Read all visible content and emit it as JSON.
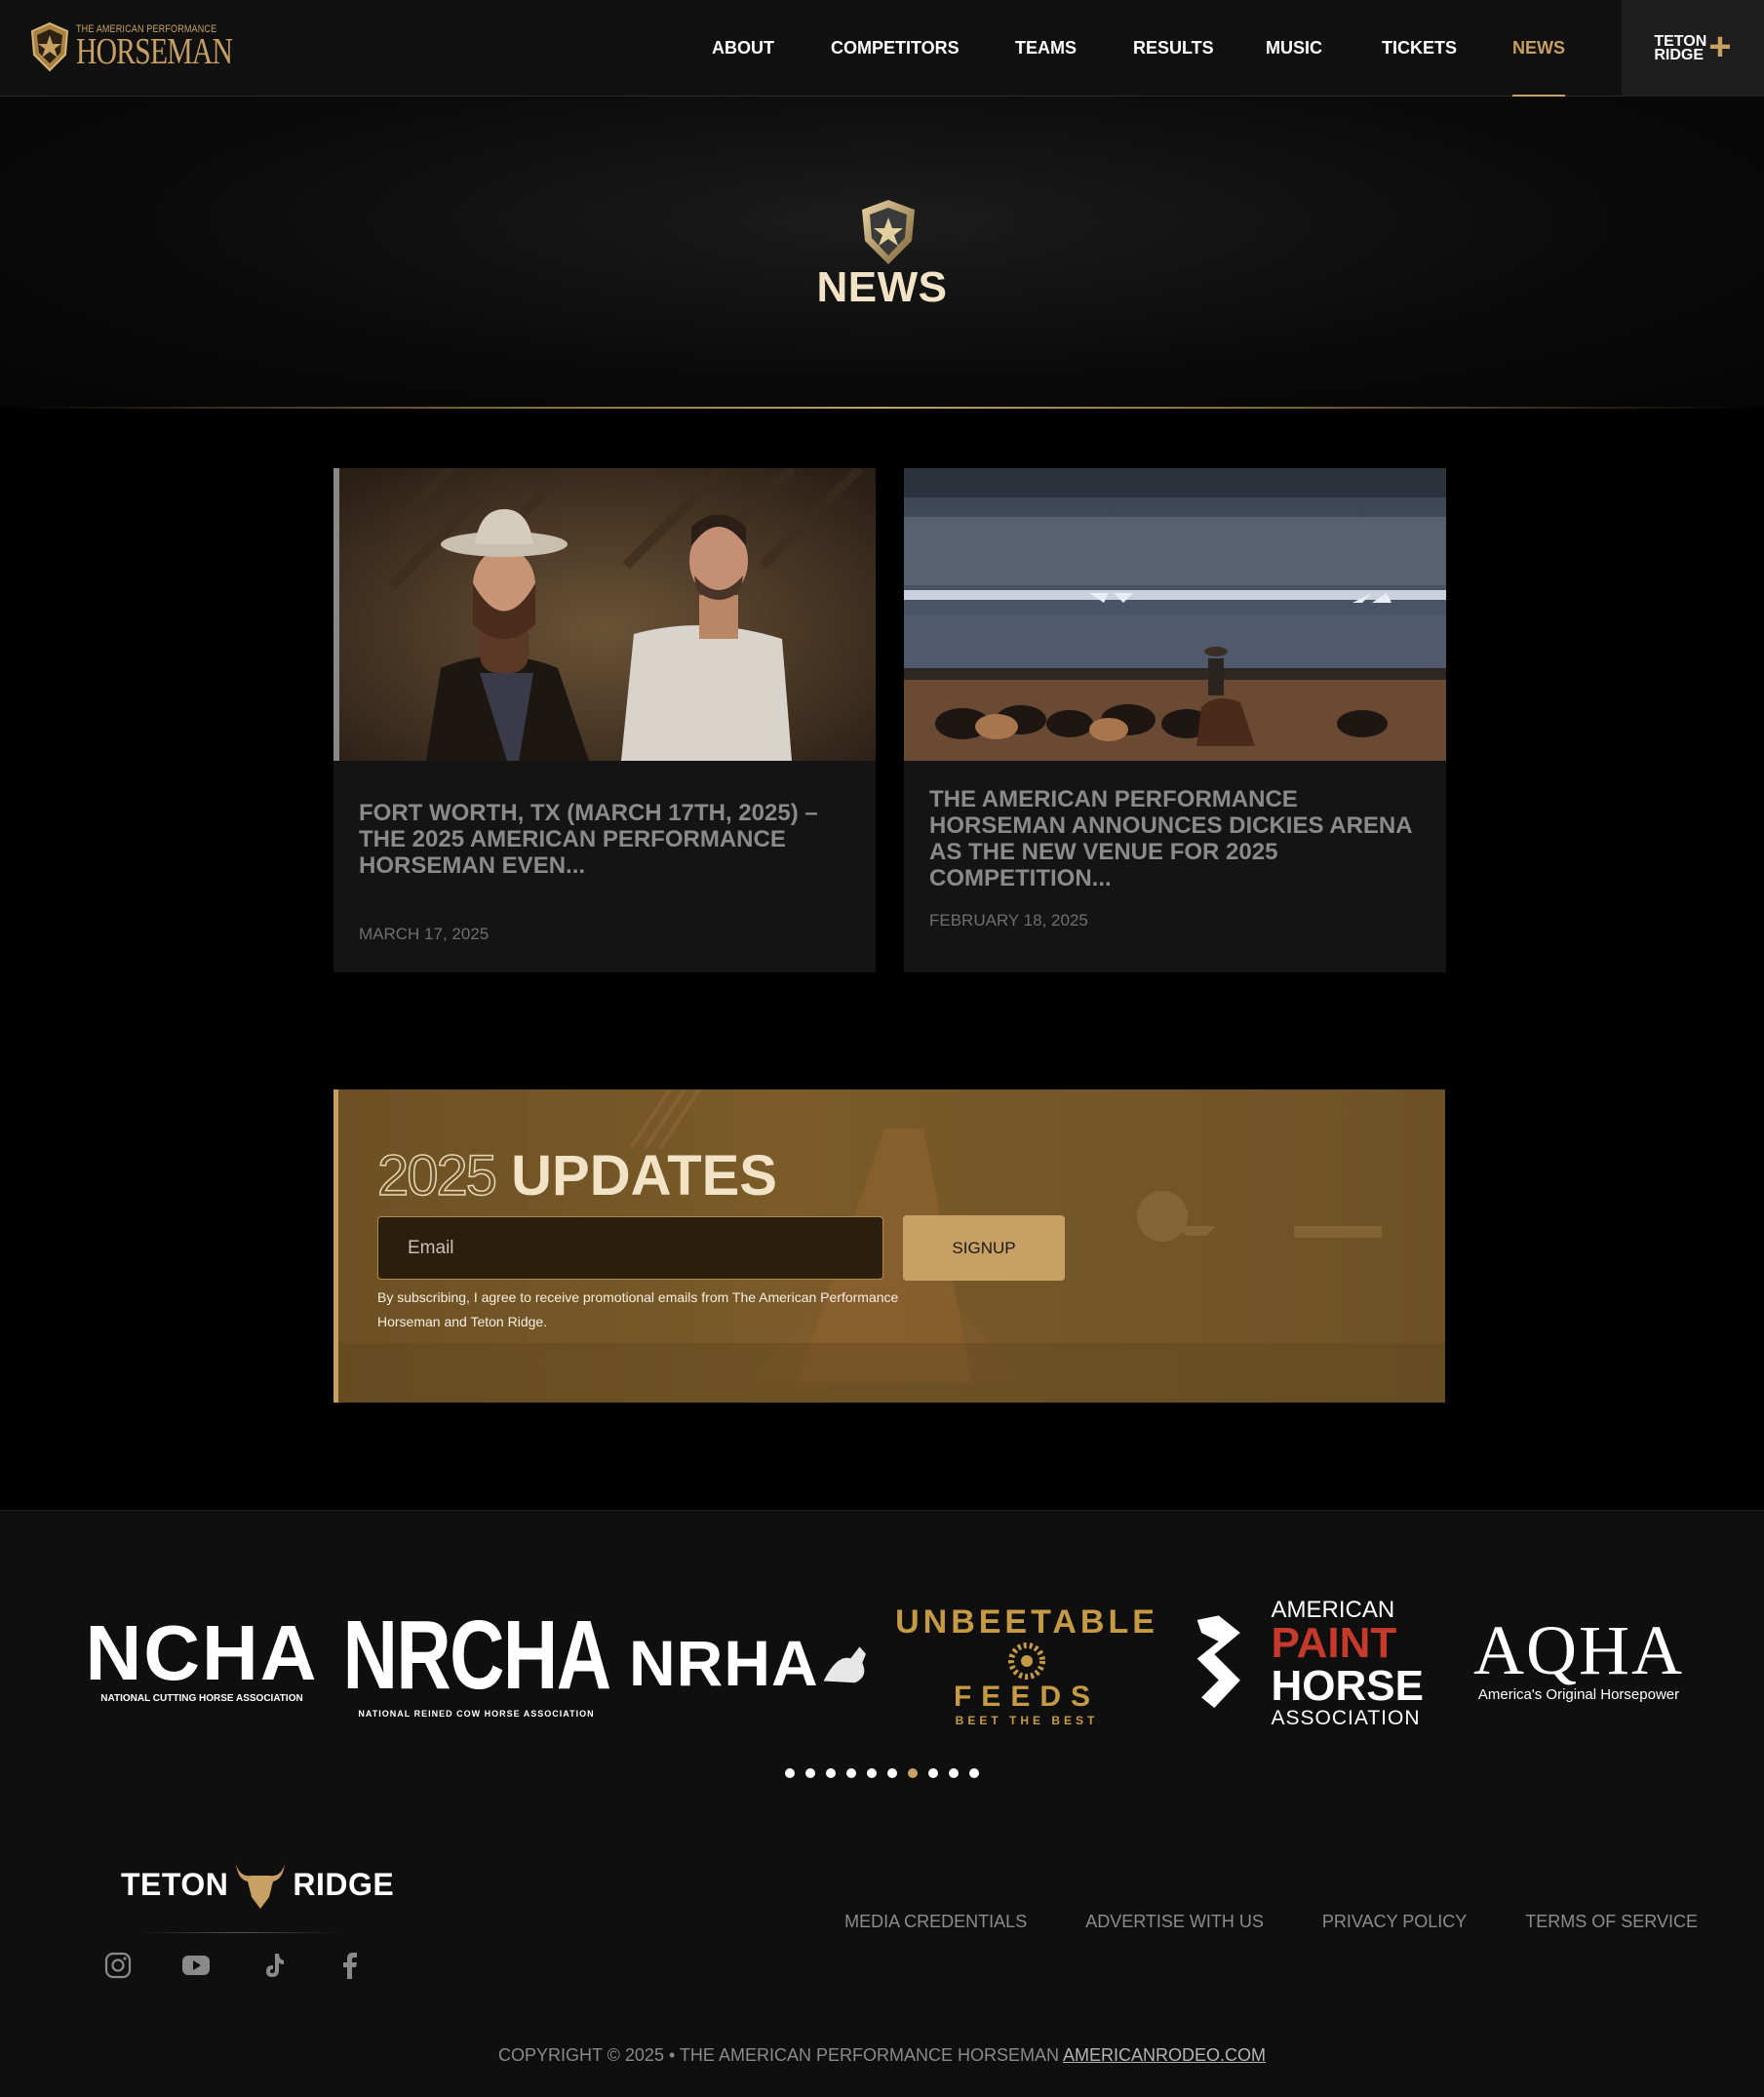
{
  "colors": {
    "accent": "#c9a063",
    "bg": "#000000",
    "nav_bg": "#111111",
    "card_bg": "#141414",
    "updates_bg": "#7a5b29"
  },
  "header": {
    "logo_small": "THE AMERICAN PERFORMANCE",
    "logo_big": "HORSEMAN",
    "nav": [
      {
        "label": "ABOUT",
        "active": false
      },
      {
        "label": "COMPETITORS",
        "active": false
      },
      {
        "label": "TEAMS",
        "active": false
      },
      {
        "label": "RESULTS",
        "active": false
      },
      {
        "label": "MUSIC",
        "active": false
      },
      {
        "label": "TICKETS",
        "active": false
      },
      {
        "label": "NEWS",
        "active": true
      }
    ],
    "teton_line1": "TETON",
    "teton_line2": "RIDGE",
    "teton_plus": "+"
  },
  "hero": {
    "title": "NEWS"
  },
  "articles": [
    {
      "title": "FORT WORTH, TX (MARCH 17TH, 2025) –THE 2025 AMERICAN PERFORMANCE HORSEMAN EVEN...",
      "date": "MARCH 17, 2025",
      "image": "two-men-portrait"
    },
    {
      "title": "THE AMERICAN PERFORMANCE HORSEMAN ANNOUNCES DICKIES ARENA AS THE NEW VENUE FOR 2025 COMPETITION...",
      "date": "FEBRUARY 18, 2025",
      "image": "arena-cattle"
    }
  ],
  "updates": {
    "year": "2025",
    "word": "UPDATES",
    "email_placeholder": "Email",
    "signup_label": "SIGNUP",
    "legal": "By subscribing, I agree to receive promotional emails from The American Performance Horseman and Teton Ridge."
  },
  "partners": [
    {
      "name": "NCHA",
      "sub": "NATIONAL CUTTING HORSE ASSOCIATION"
    },
    {
      "name": "NRCHA",
      "sub": "NATIONAL REINED COW HORSE ASSOCIATION"
    },
    {
      "name": "NRHA",
      "sub": ""
    },
    {
      "name": "UNBEETABLE",
      "line2": "FEEDS",
      "sub": "BEET THE BEST"
    },
    {
      "name": "AMERICAN",
      "line2": "PAINT",
      "line3": "HORSE",
      "sub": "ASSOCIATION"
    },
    {
      "name": "AQHA",
      "sub": "America's Original Horsepower"
    }
  ],
  "carousel": {
    "count": 10,
    "active_index": 6
  },
  "footer": {
    "logo_left": "TETON",
    "logo_right": "RIDGE",
    "social": [
      "instagram-icon",
      "youtube-icon",
      "tiktok-icon",
      "facebook-icon"
    ],
    "links": [
      "MEDIA CREDENTIALS",
      "ADVERTISE WITH US",
      "PRIVACY POLICY",
      "TERMS OF SERVICE"
    ],
    "copyright": "COPYRIGHT © 2025 • THE AMERICAN PERFORMANCE HORSEMAN",
    "copyright_link": "AMERICANRODEO.COM"
  }
}
